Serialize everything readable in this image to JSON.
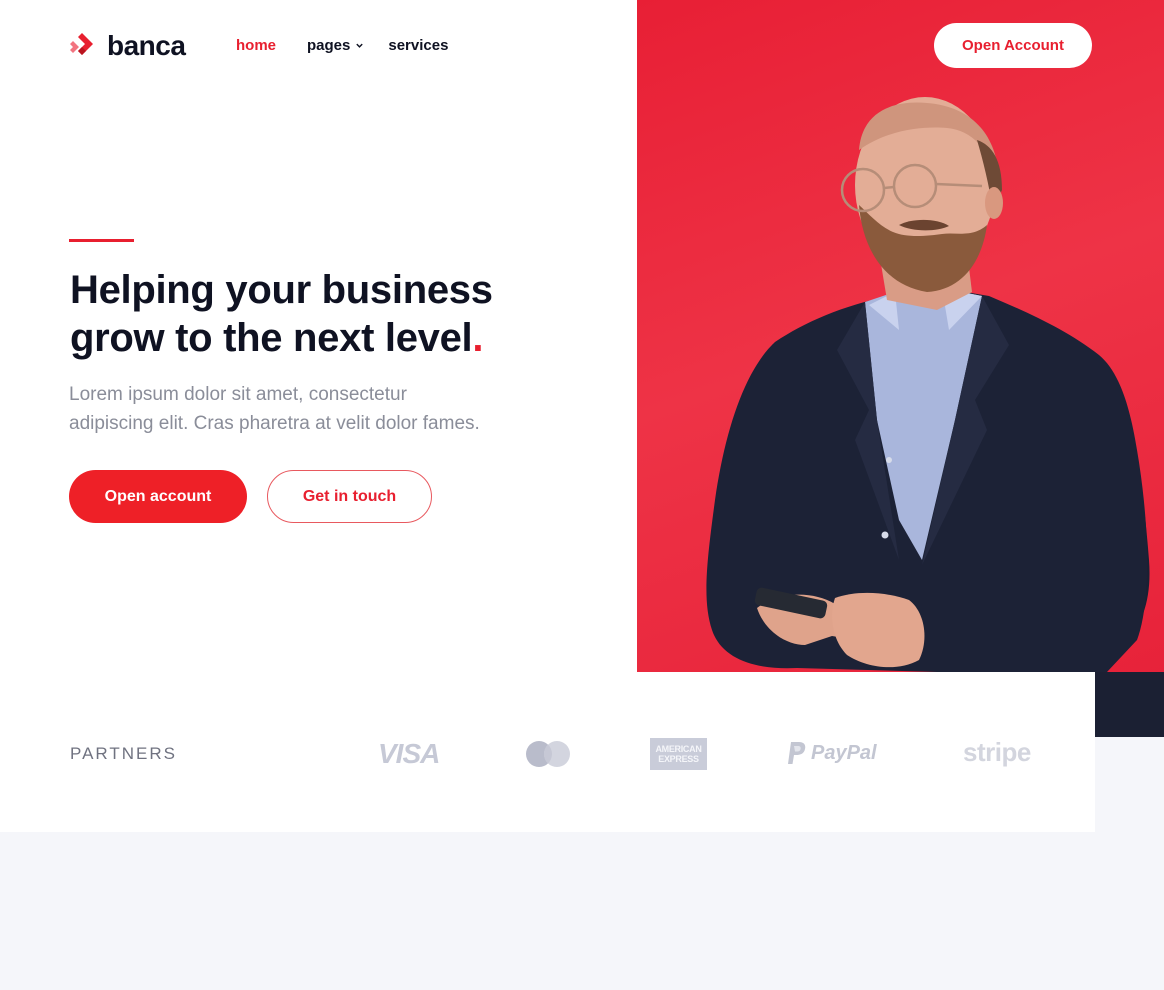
{
  "brand": {
    "name": "banca"
  },
  "nav": {
    "items": [
      {
        "label": "home",
        "active": true
      },
      {
        "label": "pages",
        "has_dropdown": true
      },
      {
        "label": "services"
      }
    ]
  },
  "header": {
    "cta_label": "Open Account"
  },
  "hero": {
    "title_line1": "Helping your business",
    "title_line2": "grow to the next level",
    "title_dot": ".",
    "subtitle_line1": "Lorem ipsum dolor sit amet, consectetur",
    "subtitle_line2": "adipiscing elit. Cras pharetra at velit dolor fames.",
    "primary_button": "Open account",
    "secondary_button": "Get in touch"
  },
  "partners": {
    "label": "PARTNERS",
    "logos": [
      {
        "name": "visa-logo",
        "text": "VISA"
      },
      {
        "name": "mastercard-logo",
        "text": ""
      },
      {
        "name": "amex-logo",
        "line1": "AMERICAN",
        "line2": "EXPRESS"
      },
      {
        "name": "paypal-logo",
        "text": "PayPal"
      },
      {
        "name": "stripe-logo",
        "text": "stripe"
      }
    ]
  },
  "colors": {
    "accent": "#e81f2f",
    "hero_background": "#ec2d3f",
    "text_dark": "#0f1222",
    "text_muted": "#8a8d99",
    "logo_gray": "#c3c6d2",
    "page_background": "#f5f6fa"
  }
}
